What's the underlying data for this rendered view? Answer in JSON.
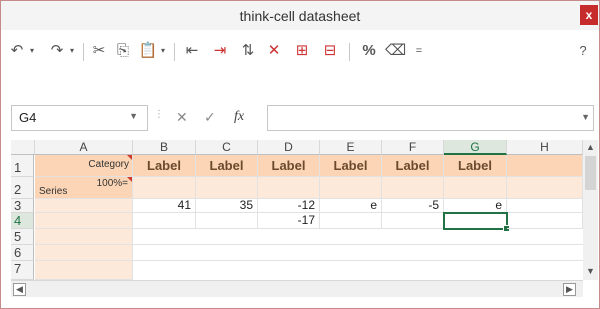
{
  "window": {
    "title": "think-cell datasheet",
    "close_label": "x"
  },
  "toolbar": {
    "undo": "↶",
    "redo": "↷",
    "cut": "✂",
    "copy": "⎘",
    "paste": "📋",
    "b1": "⇤",
    "b2": "⇥",
    "b3": "⇅",
    "b4": "✕",
    "b5": "⊞",
    "b6": "⊟",
    "percent": "%",
    "clear": "⌫",
    "more": "=",
    "help": "?"
  },
  "formula_bar": {
    "name_box": "G4",
    "cancel": "✕",
    "enter": "✓",
    "fx": "fx",
    "value": ""
  },
  "sheet": {
    "columns": [
      "A",
      "B",
      "C",
      "D",
      "E",
      "F",
      "G",
      "H"
    ],
    "selected_column": "G",
    "rows": [
      "1",
      "2",
      "3",
      "4",
      "5",
      "6",
      "7"
    ],
    "selected_row": "4",
    "category_label": "Category",
    "series_label": "Series",
    "percent_label": "100%=",
    "header_labels": [
      "Label",
      "Label",
      "Label",
      "Label",
      "Label",
      "Label"
    ],
    "row3": [
      "41",
      "35",
      "-12",
      "e",
      "-5",
      "e"
    ],
    "row4_d": "-17"
  },
  "colors": {
    "accent_green": "#217346",
    "header_orange": "#fbd5b5",
    "close_red": "#c72c2c"
  }
}
